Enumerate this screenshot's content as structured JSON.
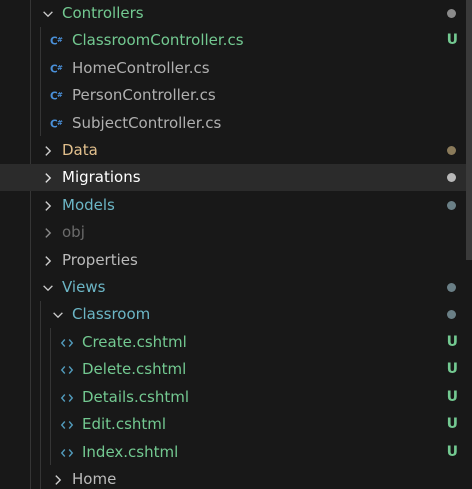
{
  "colors": {
    "folder_untracked": "#73c991",
    "folder_modified": "#e2c08d",
    "folder_ignored": "#6b6b6b",
    "folder_plain": "#cccccc",
    "folder_views": "#6cb6c6",
    "file_untracked": "#73c991",
    "file_plain": "#b0b0b0",
    "cs_icon": "#4a90d9",
    "html_icon": "#519aba",
    "dot_default": "#8a8a8a",
    "dot_modified": "#8a7a5a"
  },
  "tree": {
    "controllers": {
      "label": "Controllers",
      "icon": "chevron-down-icon"
    },
    "classroom_controller": {
      "label": "ClassroomController.cs",
      "icon": "csharp-file-icon",
      "status": "U"
    },
    "home_controller": {
      "label": "HomeController.cs",
      "icon": "csharp-file-icon"
    },
    "person_controller": {
      "label": "PersonController.cs",
      "icon": "csharp-file-icon"
    },
    "subject_controller": {
      "label": "SubjectController.cs",
      "icon": "csharp-file-icon"
    },
    "data": {
      "label": "Data",
      "icon": "chevron-right-icon"
    },
    "migrations": {
      "label": "Migrations",
      "icon": "chevron-right-icon"
    },
    "models": {
      "label": "Models",
      "icon": "chevron-right-icon"
    },
    "obj": {
      "label": "obj",
      "icon": "chevron-right-icon"
    },
    "properties": {
      "label": "Properties",
      "icon": "chevron-right-icon"
    },
    "views": {
      "label": "Views",
      "icon": "chevron-down-icon"
    },
    "classroom": {
      "label": "Classroom",
      "icon": "chevron-down-icon"
    },
    "create": {
      "label": "Create.cshtml",
      "icon": "html-file-icon",
      "status": "U"
    },
    "delete": {
      "label": "Delete.cshtml",
      "icon": "html-file-icon",
      "status": "U"
    },
    "details": {
      "label": "Details.cshtml",
      "icon": "html-file-icon",
      "status": "U"
    },
    "edit": {
      "label": "Edit.cshtml",
      "icon": "html-file-icon",
      "status": "U"
    },
    "index": {
      "label": "Index.cshtml",
      "icon": "html-file-icon",
      "status": "U"
    },
    "home": {
      "label": "Home",
      "icon": "chevron-right-icon"
    }
  }
}
